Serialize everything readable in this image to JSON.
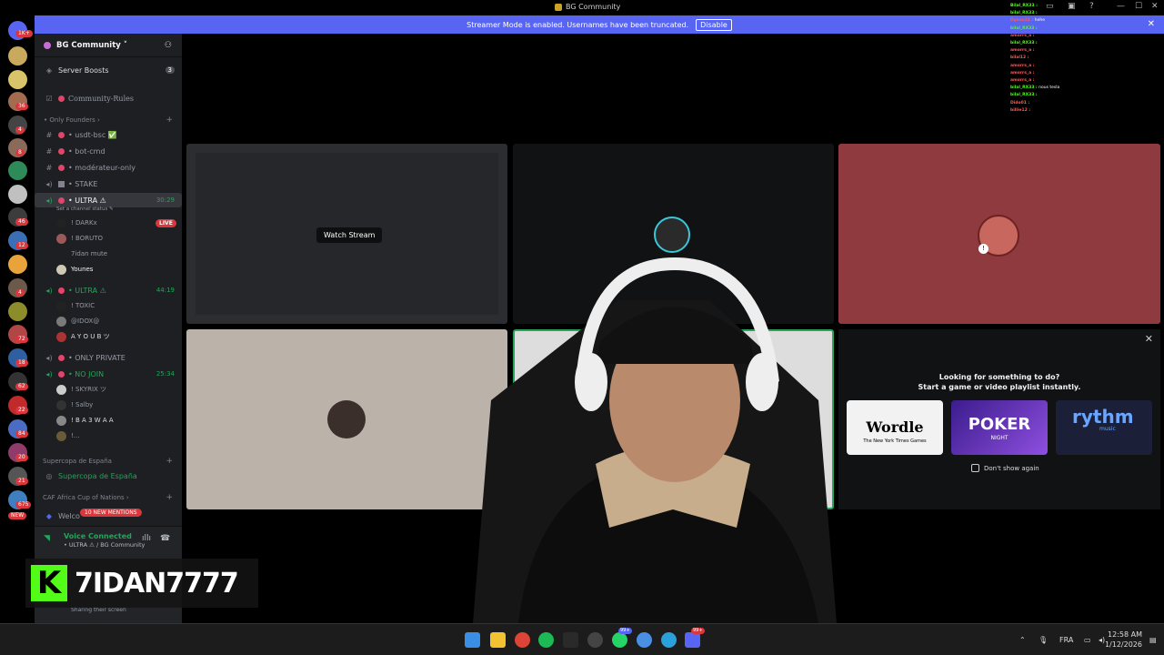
{
  "window": {
    "title": "BG Community"
  },
  "banner": {
    "text": "Streamer Mode is enabled. Usernames have been truncated.",
    "disable_label": "Disable"
  },
  "server": {
    "name": "BG Community ˅"
  },
  "sidebar": {
    "boosts_label": "Server Boosts",
    "boosts_count": "3",
    "rules_label": "Community-Rules",
    "cat_founders": "• Only Founders ›",
    "ch_usdt": "• usdt-bsc ✅",
    "ch_bot": "• bot-cmd",
    "ch_moderateur": "• modérateur-only",
    "ch_stake": "• STAKE",
    "vc1_name": "• ULTRA ⚠",
    "vc1_time": "30:29",
    "vc1_status": "Set a channel status ✎",
    "vc1_members": [
      "! DARKx",
      "! BORUTO",
      "7idan mute",
      "Younes"
    ],
    "live_label": "LIVE",
    "vc2_name": "• ULTRA ⚠",
    "vc2_time": "44:19",
    "vc2_members": [
      "! TOXIC",
      "@IDOX@",
      "A Y O U B ツ"
    ],
    "vc3_name": "• ONLY PRIVATE",
    "vc4_name": "• NO JOIN",
    "vc4_time": "25:34",
    "vc4_members": [
      "! SKYRIX ツ",
      "! Salby",
      "! B A 3 W A A",
      "!..."
    ],
    "cat_supercopa": "Supercopa de España",
    "ch_supercopa": "Supercopa de España",
    "cat_caf": "CAF Africa Cup of Nations ›",
    "ch_welcome": "Welco",
    "mentions_label": "10 NEW MENTIONS"
  },
  "voice": {
    "status": "Voice Connected",
    "channel": "• ULTRA ⚠ / BG Community",
    "sharing": "Sharing their screen"
  },
  "rail_badges": [
    "1K+",
    "36",
    "4",
    "8",
    "46",
    "12",
    "4",
    "72",
    "18",
    "62",
    "22",
    "84",
    "20",
    "21",
    "675",
    "NEW"
  ],
  "brand": {
    "k": "K",
    "name": "7IDAN7777"
  },
  "stage": {
    "watch_label": "Watch Stream"
  },
  "activity": {
    "line1": "Looking for something to do?",
    "line2": "Start a game or video playlist instantly.",
    "wordle_title": "Wordle",
    "wordle_sub": "The New York Times Games",
    "poker_title": "POKER",
    "poker_sub": "NIGHT",
    "rythm_title": "rythm",
    "rythm_sub": "music",
    "dont_show": "Don't show again"
  },
  "chat": [
    {
      "user": "Bilal_RX33 :",
      "msg": "",
      "green": true
    },
    {
      "user": "bilal_RX33 :",
      "msg": "",
      "green": true
    },
    {
      "user": "Dyson24 :",
      "msg": "hehe",
      "green": false
    },
    {
      "user": "bilal_RX33 :",
      "msg": "",
      "green": true
    },
    {
      "user": "amorrs_a :",
      "msg": "",
      "green": false
    },
    {
      "user": "bilal_RX33 :",
      "msg": "",
      "green": true
    },
    {
      "user": "amorrs_a :",
      "msg": "",
      "green": false
    },
    {
      "user": "bilal12 :",
      "msg": "",
      "green": false
    },
    {
      "user": "amorrs_a :",
      "msg": "",
      "green": false
    },
    {
      "user": "amorrs_a :",
      "msg": "",
      "green": false
    },
    {
      "user": "amorrs_a :",
      "msg": "",
      "green": false
    },
    {
      "user": "bilal_RX33 :",
      "msg": "nous tesla",
      "green": true
    },
    {
      "user": "bilal_RX33 :",
      "msg": "",
      "green": true
    },
    {
      "user": "Dido01 :",
      "msg": "",
      "green": false
    },
    {
      "user": "billie12 :",
      "msg": "",
      "green": false
    }
  ],
  "taskbar": {
    "lang": "FRA",
    "time": "12:58 AM",
    "date": "1/12/2026",
    "badge_whatsapp": "99+",
    "badge_discord": "99+"
  },
  "colors": {
    "blurple": "#5865f2",
    "kick_green": "#53fc18",
    "voice_green": "#23a55a",
    "mention_red": "#da373c"
  }
}
